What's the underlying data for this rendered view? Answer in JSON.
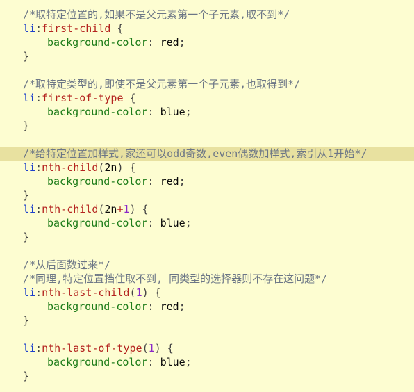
{
  "editor": {
    "colors": {
      "background": "#FDFDD1",
      "highlight_line": "#E8E1A0",
      "comment": "#6C7686",
      "selector": "#1C3FCB",
      "pseudo_class": "#B4231F",
      "property": "#1D7C19",
      "number": "#8A27C8"
    },
    "lines": [
      {
        "comment": "/*取特定位置的,如果不是父元素第一个子元素,取不到*/"
      },
      {
        "selector": "li",
        "colon": ":",
        "pseudo": "first-child",
        "brace": " {"
      },
      {
        "property": "background-color",
        "colon": ": ",
        "value": "red",
        "semi": ";"
      },
      {
        "brace": "}"
      },
      {},
      {
        "comment": "/*取特定类型的,即使不是父元素第一个子元素,也取得到*/"
      },
      {
        "selector": "li",
        "colon": ":",
        "pseudo": "first-of-type",
        "brace": " {"
      },
      {
        "property": "background-color",
        "colon": ": ",
        "value": "blue",
        "semi": ";"
      },
      {
        "brace": "}"
      },
      {},
      {
        "comment": "/*给特定位置加样式,家还可以odd奇数,even偶数加样式,索引从1开始*/"
      },
      {
        "selector": "li",
        "colon": ":",
        "pseudo": "nth-child",
        "open": "(",
        "arg": "2n",
        "close": ")",
        "brace": " {"
      },
      {
        "property": "background-color",
        "colon": ": ",
        "value": "red",
        "semi": ";"
      },
      {
        "brace": "}"
      },
      {
        "selector": "li",
        "colon": ":",
        "pseudo": "nth-child",
        "open": "(",
        "arg": "2n",
        "op": "+",
        "num": "1",
        "close": ")",
        "brace": " {"
      },
      {
        "property": "background-color",
        "colon": ": ",
        "value": "blue",
        "semi": ";"
      },
      {
        "brace": "}"
      },
      {},
      {
        "comment": "/*从后面数过来*/"
      },
      {
        "comment": "/*同理,特定位置挡住取不到, 同类型的选择器则不存在这问题*/"
      },
      {
        "selector": "li",
        "colon": ":",
        "pseudo": "nth-last-child",
        "open": "(",
        "num": "1",
        "close": ")",
        "brace": " {"
      },
      {
        "property": "background-color",
        "colon": ": ",
        "value": "red",
        "semi": ";"
      },
      {
        "brace": "}"
      },
      {},
      {
        "selector": "li",
        "colon": ":",
        "pseudo": "nth-last-of-type",
        "open": "(",
        "num": "1",
        "close": ")",
        "brace": " {"
      },
      {
        "property": "background-color",
        "colon": ": ",
        "value": "blue",
        "semi": ";"
      },
      {
        "brace": "}"
      }
    ]
  }
}
